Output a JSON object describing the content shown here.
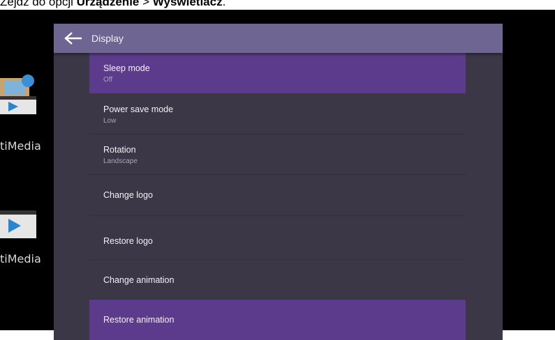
{
  "document": {
    "prefix": "Zejdź do opcji ",
    "bold1": "Urządzenie",
    "sep": " > ",
    "bold2": "Wyświetlacz",
    "suffix": "."
  },
  "desktop": {
    "app_label_1": "tiMedia",
    "app_label_2": "tiMedia"
  },
  "header": {
    "title": "Display",
    "back_icon": "arrow-left-icon"
  },
  "items": [
    {
      "title": "Sleep mode",
      "value": "Off",
      "selected": true
    },
    {
      "title": "Power save mode",
      "value": "Low",
      "selected": false
    },
    {
      "title": "Rotation",
      "value": "Landscape",
      "selected": false
    },
    {
      "title": "Change logo",
      "value": "",
      "selected": false
    },
    {
      "title": "Restore logo",
      "value": "",
      "selected": false
    },
    {
      "title": "Change animation",
      "value": "",
      "selected": false
    },
    {
      "title": "Restore animation",
      "value": "",
      "selected": true
    }
  ],
  "colors": {
    "header": "#6e6592",
    "panel": "#3b3747",
    "selected": "#5c3b8c",
    "background": "#000000"
  }
}
